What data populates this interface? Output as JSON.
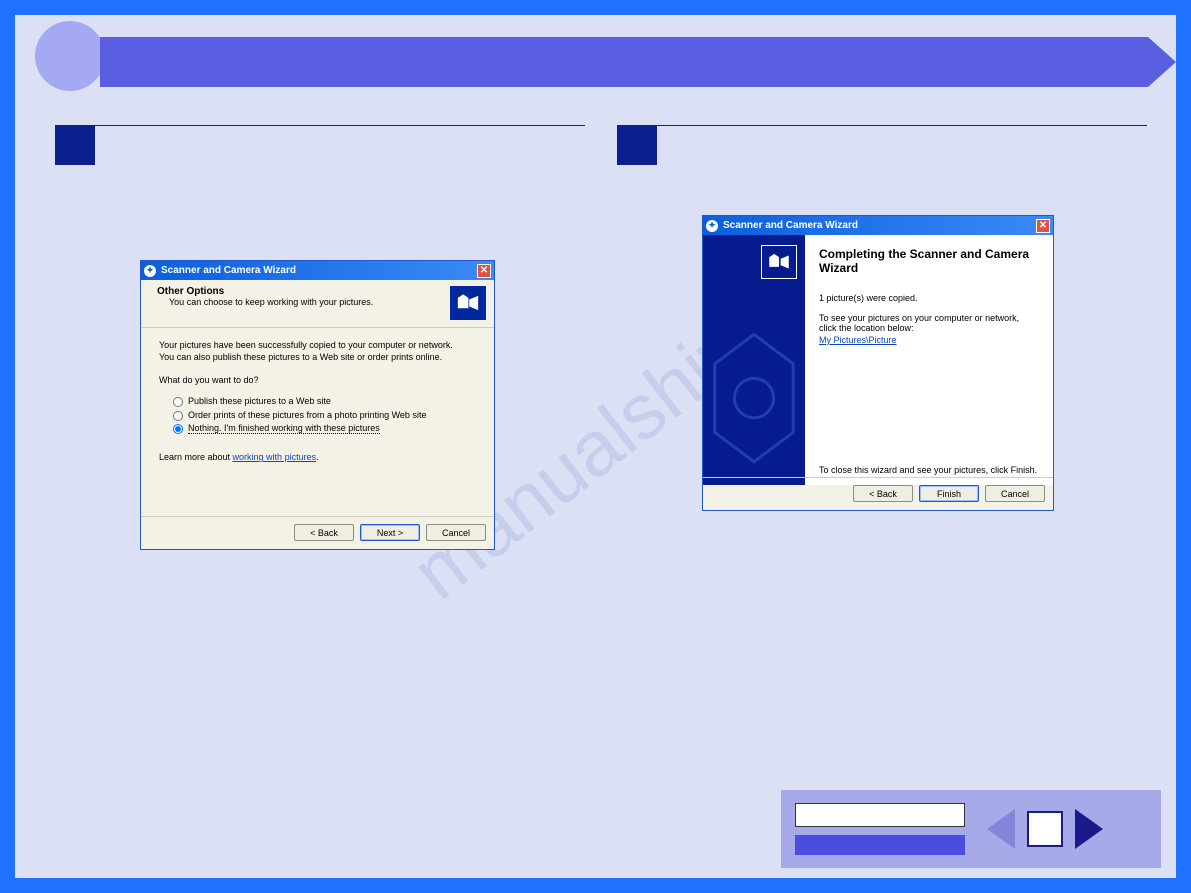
{
  "watermark": "manualshive",
  "wizard_left": {
    "title": "Scanner and Camera Wizard",
    "header_title": "Other Options",
    "header_sub": "You can choose to keep working with your pictures.",
    "body_intro1": "Your pictures have been successfully copied to your computer or network.",
    "body_intro2": "You can also publish these pictures to a Web site or order prints online.",
    "question": "What do you want to do?",
    "opt_publish": "Publish these pictures to a Web site",
    "opt_order": "Order prints of these pictures from a photo printing Web site",
    "opt_nothing": "Nothing. I'm finished working with these pictures",
    "learn_prefix": "Learn more about ",
    "learn_link": "working with pictures",
    "btn_back": "< Back",
    "btn_next": "Next >",
    "btn_cancel": "Cancel"
  },
  "wizard_right": {
    "title": "Scanner and Camera Wizard",
    "complete_title": "Completing the Scanner and Camera Wizard",
    "copied_text": "1 picture(s) were copied.",
    "see_text": "To see your pictures on your computer or network, click the location below:",
    "link_path": "My Pictures\\Picture",
    "close_text": "To close this wizard and see your pictures, click Finish.",
    "btn_back": "< Back",
    "btn_finish": "Finish",
    "btn_cancel": "Cancel"
  }
}
